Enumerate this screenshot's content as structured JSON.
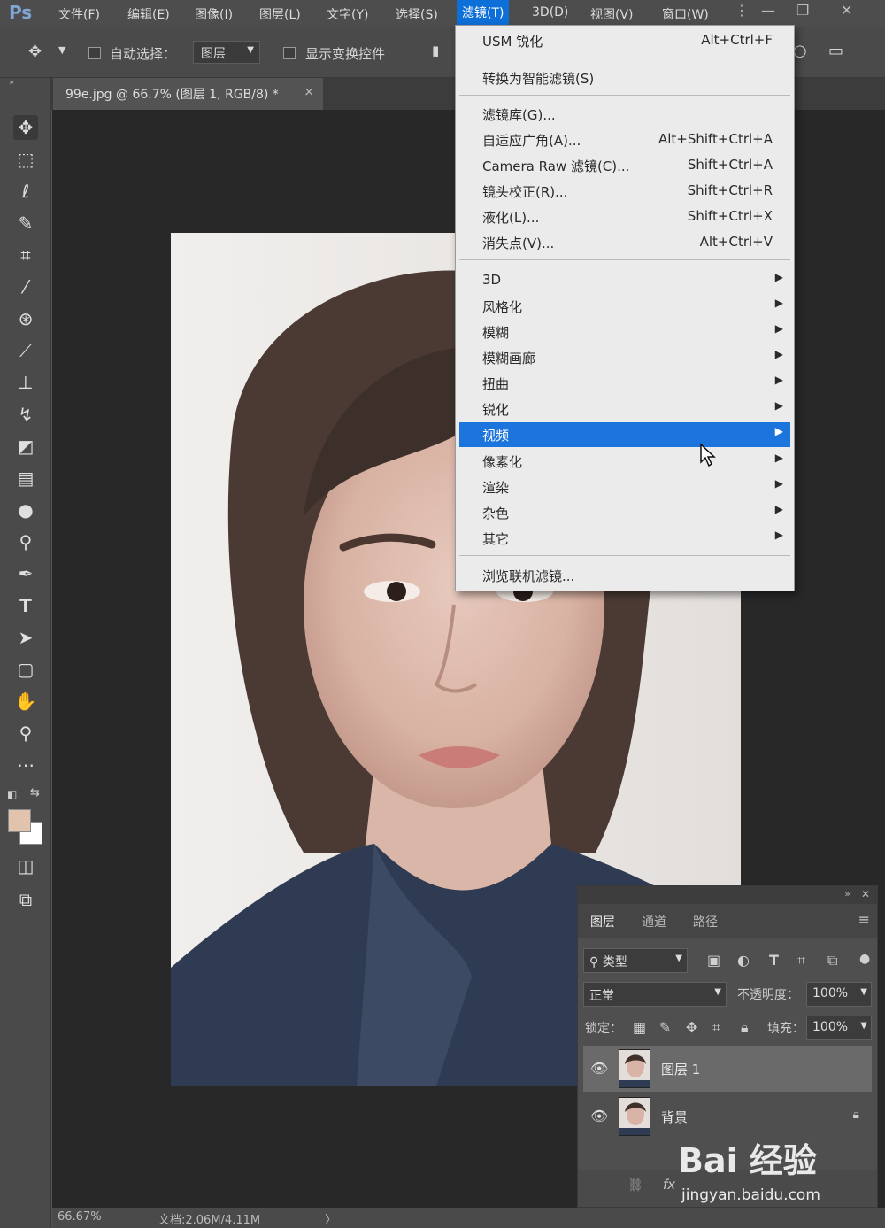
{
  "app": {
    "logo": "Ps"
  },
  "menubar": {
    "items": [
      "文件(F)",
      "编辑(E)",
      "图像(I)",
      "图层(L)",
      "文字(Y)",
      "选择(S)",
      "滤镜(T)",
      "3D(D)",
      "视图(V)",
      "窗口(W)"
    ],
    "active_index": 6
  },
  "options": {
    "auto_select_label": "自动选择：",
    "auto_select_value": "图层",
    "show_transform_label": "显示变换控件"
  },
  "document": {
    "tab_title": "99e.jpg @ 66.7% (图层 1, RGB/8) *",
    "tab_close": "×"
  },
  "filter_menu": {
    "top_items": [
      {
        "label": "USM 锐化",
        "shortcut": "Alt+Ctrl+F"
      }
    ],
    "smart_item": {
      "label": "转换为智能滤镜(S)"
    },
    "filter_items": [
      {
        "label": "滤镜库(G)...",
        "shortcut": ""
      },
      {
        "label": "自适应广角(A)...",
        "shortcut": "Alt+Shift+Ctrl+A"
      },
      {
        "label": "Camera Raw 滤镜(C)...",
        "shortcut": "Shift+Ctrl+A"
      },
      {
        "label": "镜头校正(R)...",
        "shortcut": "Shift+Ctrl+R"
      },
      {
        "label": "液化(L)...",
        "shortcut": "Shift+Ctrl+X"
      },
      {
        "label": "消失点(V)...",
        "shortcut": "Alt+Ctrl+V"
      }
    ],
    "submenus": [
      "3D",
      "风格化",
      "模糊",
      "模糊画廊",
      "扭曲",
      "锐化",
      "视频",
      "像素化",
      "渲染",
      "杂色",
      "其它"
    ],
    "highlighted_submenu_index": 6,
    "browse_item": {
      "label": "浏览联机滤镜..."
    }
  },
  "layers_panel": {
    "tabs": [
      "图层",
      "通道",
      "路径"
    ],
    "filter_kind": "类型",
    "blend_mode": "正常",
    "opacity_label": "不透明度：",
    "opacity_value": "100%",
    "lock_label": "锁定：",
    "fill_label": "填充：",
    "fill_value": "100%",
    "layers": [
      {
        "name": "图层 1",
        "selected": true,
        "locked": false
      },
      {
        "name": "背景",
        "selected": false,
        "locked": true
      }
    ],
    "fx_label": "fx"
  },
  "status": {
    "zoom": "66.67%",
    "doc_info": "文档:2.06M/4.11M"
  },
  "watermark": {
    "brand": "Bai 经验",
    "url": "jingyan.baidu.com"
  },
  "colors": {
    "foreground": "#e2c3ae",
    "background": "#ffffff",
    "menu_highlight": "#1c74dd",
    "active_menu": "#0d6fd8"
  }
}
